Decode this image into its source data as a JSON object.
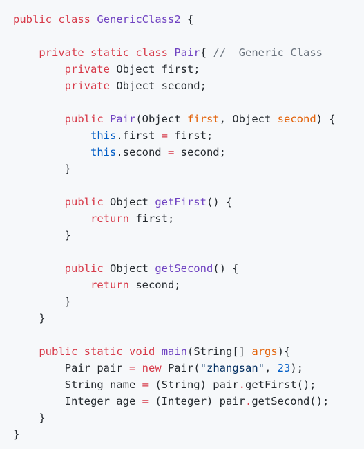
{
  "code": {
    "lines": [
      [
        {
          "t": "public",
          "c": "kw"
        },
        {
          "t": " ",
          "c": "plain"
        },
        {
          "t": "class",
          "c": "kw"
        },
        {
          "t": " ",
          "c": "plain"
        },
        {
          "t": "GenericClass2",
          "c": "fn"
        },
        {
          "t": " {",
          "c": "plain"
        }
      ],
      [],
      [
        {
          "t": "    ",
          "c": "plain"
        },
        {
          "t": "private",
          "c": "kw"
        },
        {
          "t": " ",
          "c": "plain"
        },
        {
          "t": "static",
          "c": "kw"
        },
        {
          "t": " ",
          "c": "plain"
        },
        {
          "t": "class",
          "c": "kw"
        },
        {
          "t": " ",
          "c": "plain"
        },
        {
          "t": "Pair",
          "c": "fn"
        },
        {
          "t": "{ ",
          "c": "plain"
        },
        {
          "t": "//  Generic Class",
          "c": "cm"
        }
      ],
      [
        {
          "t": "        ",
          "c": "plain"
        },
        {
          "t": "private",
          "c": "kw"
        },
        {
          "t": " Object first;",
          "c": "plain"
        }
      ],
      [
        {
          "t": "        ",
          "c": "plain"
        },
        {
          "t": "private",
          "c": "kw"
        },
        {
          "t": " Object second;",
          "c": "plain"
        }
      ],
      [],
      [
        {
          "t": "        ",
          "c": "plain"
        },
        {
          "t": "public",
          "c": "kw"
        },
        {
          "t": " ",
          "c": "plain"
        },
        {
          "t": "Pair",
          "c": "fn"
        },
        {
          "t": "(Object ",
          "c": "plain"
        },
        {
          "t": "first",
          "c": "param"
        },
        {
          "t": ", Object ",
          "c": "plain"
        },
        {
          "t": "second",
          "c": "param"
        },
        {
          "t": ") {",
          "c": "plain"
        }
      ],
      [
        {
          "t": "            ",
          "c": "plain"
        },
        {
          "t": "this",
          "c": "this"
        },
        {
          "t": ".first ",
          "c": "plain"
        },
        {
          "t": "=",
          "c": "op"
        },
        {
          "t": " first;",
          "c": "plain"
        }
      ],
      [
        {
          "t": "            ",
          "c": "plain"
        },
        {
          "t": "this",
          "c": "this"
        },
        {
          "t": ".second ",
          "c": "plain"
        },
        {
          "t": "=",
          "c": "op"
        },
        {
          "t": " second;",
          "c": "plain"
        }
      ],
      [
        {
          "t": "        }",
          "c": "plain"
        }
      ],
      [],
      [
        {
          "t": "        ",
          "c": "plain"
        },
        {
          "t": "public",
          "c": "kw"
        },
        {
          "t": " Object ",
          "c": "plain"
        },
        {
          "t": "getFirst",
          "c": "fn"
        },
        {
          "t": "() {",
          "c": "plain"
        }
      ],
      [
        {
          "t": "            ",
          "c": "plain"
        },
        {
          "t": "return",
          "c": "kw"
        },
        {
          "t": " first;",
          "c": "plain"
        }
      ],
      [
        {
          "t": "        }",
          "c": "plain"
        }
      ],
      [],
      [
        {
          "t": "        ",
          "c": "plain"
        },
        {
          "t": "public",
          "c": "kw"
        },
        {
          "t": " Object ",
          "c": "plain"
        },
        {
          "t": "getSecond",
          "c": "fn"
        },
        {
          "t": "() {",
          "c": "plain"
        }
      ],
      [
        {
          "t": "            ",
          "c": "plain"
        },
        {
          "t": "return",
          "c": "kw"
        },
        {
          "t": " second;",
          "c": "plain"
        }
      ],
      [
        {
          "t": "        }",
          "c": "plain"
        }
      ],
      [
        {
          "t": "    }",
          "c": "plain"
        }
      ],
      [],
      [
        {
          "t": "    ",
          "c": "plain"
        },
        {
          "t": "public",
          "c": "kw"
        },
        {
          "t": " ",
          "c": "plain"
        },
        {
          "t": "static",
          "c": "kw"
        },
        {
          "t": " ",
          "c": "plain"
        },
        {
          "t": "void",
          "c": "kw"
        },
        {
          "t": " ",
          "c": "plain"
        },
        {
          "t": "main",
          "c": "fn"
        },
        {
          "t": "(String[] ",
          "c": "plain"
        },
        {
          "t": "args",
          "c": "param"
        },
        {
          "t": "){",
          "c": "plain"
        }
      ],
      [
        {
          "t": "        Pair pair ",
          "c": "plain"
        },
        {
          "t": "=",
          "c": "op"
        },
        {
          "t": " ",
          "c": "plain"
        },
        {
          "t": "new",
          "c": "kw"
        },
        {
          "t": " Pair(",
          "c": "plain"
        },
        {
          "t": "\"zhangsan\"",
          "c": "str"
        },
        {
          "t": ", ",
          "c": "plain"
        },
        {
          "t": "23",
          "c": "num"
        },
        {
          "t": ");",
          "c": "plain"
        }
      ],
      [
        {
          "t": "        String name ",
          "c": "plain"
        },
        {
          "t": "=",
          "c": "op"
        },
        {
          "t": " (String) pair",
          "c": "plain"
        },
        {
          "t": ".",
          "c": "op"
        },
        {
          "t": "getFirst();",
          "c": "plain"
        }
      ],
      [
        {
          "t": "        Integer age ",
          "c": "plain"
        },
        {
          "t": "=",
          "c": "op"
        },
        {
          "t": " (Integer) pair",
          "c": "plain"
        },
        {
          "t": ".",
          "c": "op"
        },
        {
          "t": "getSecond();",
          "c": "plain"
        }
      ],
      [
        {
          "t": "    }",
          "c": "plain"
        }
      ],
      [
        {
          "t": "}",
          "c": "plain"
        }
      ]
    ]
  }
}
